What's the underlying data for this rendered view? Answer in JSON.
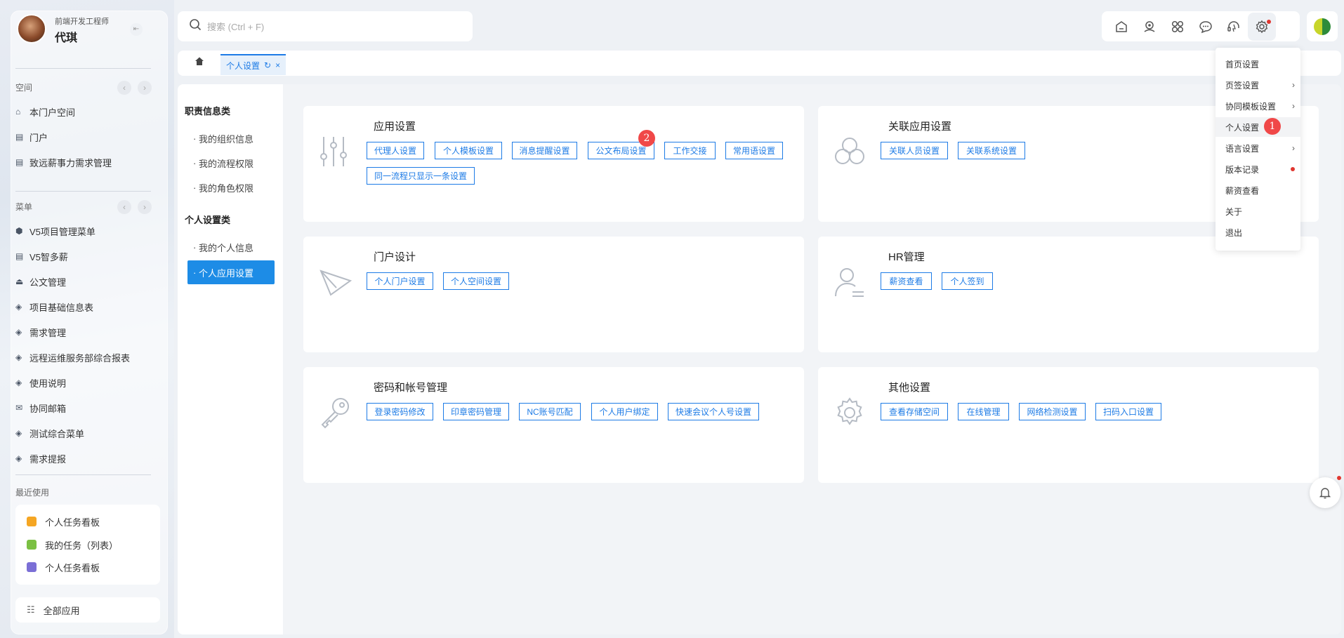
{
  "user": {
    "role": "前端开发工程师",
    "name": "代琪"
  },
  "sidebar": {
    "space_label": "空间",
    "space_items": [
      {
        "label": "本门户空间",
        "icon": "home-icon"
      },
      {
        "label": "门户",
        "icon": "doc-icon"
      },
      {
        "label": "致远薪事力需求管理",
        "icon": "doc-icon"
      }
    ],
    "menu_label": "菜单",
    "menu_items": [
      {
        "label": "V5项目管理菜单",
        "icon": "cube-icon"
      },
      {
        "label": "V5智多薪",
        "icon": "doc-icon"
      },
      {
        "label": "公文管理",
        "icon": "stamp-icon"
      },
      {
        "label": "项目基础信息表",
        "icon": "layers-icon"
      },
      {
        "label": "需求管理",
        "icon": "layers-icon"
      },
      {
        "label": "远程运维服务部综合报表",
        "icon": "layers-icon"
      },
      {
        "label": "使用说明",
        "icon": "layers-icon"
      },
      {
        "label": "协同邮箱",
        "icon": "mail-icon"
      },
      {
        "label": "测试综合菜单",
        "icon": "layers-icon"
      },
      {
        "label": "需求提报",
        "icon": "layers-icon"
      }
    ],
    "recent_label": "最近使用",
    "recent_items": [
      {
        "label": "个人任务看板",
        "color": "#f5a623"
      },
      {
        "label": "我的任务（列表）",
        "color": "#7bc043"
      },
      {
        "label": "个人任务看板",
        "color": "#7b6fd6"
      }
    ],
    "all_apps": "全部应用"
  },
  "search": {
    "placeholder": "搜索 (Ctrl + F)"
  },
  "tabs": {
    "active": "个人设置"
  },
  "left_menu": {
    "group1": "职责信息类",
    "group1_items": [
      "我的组织信息",
      "我的流程权限",
      "我的角色权限"
    ],
    "group2": "个人设置类",
    "group2_items": [
      "我的个人信息",
      "个人应用设置"
    ]
  },
  "cards": [
    {
      "title": "应用设置",
      "chips": [
        "代理人设置",
        "个人模板设置",
        "消息提醒设置",
        "公文布局设置",
        "工作交接",
        "常用语设置",
        "同一流程只显示一条设置"
      ]
    },
    {
      "title": "关联应用设置",
      "chips": [
        "关联人员设置",
        "关联系统设置"
      ]
    },
    {
      "title": "门户设计",
      "chips": [
        "个人门户设置",
        "个人空间设置"
      ]
    },
    {
      "title": "HR管理",
      "chips": [
        "薪资查看",
        "个人签到"
      ]
    },
    {
      "title": "密码和帐号管理",
      "chips": [
        "登录密码修改",
        "印章密码管理",
        "NC账号匹配",
        "个人用户绑定",
        "快速会议个人号设置"
      ]
    },
    {
      "title": "其他设置",
      "chips": [
        "查看存储空间",
        "在线管理",
        "网络检测设置",
        "扫码入口设置"
      ]
    }
  ],
  "badges": {
    "step1": "1",
    "step2": "2"
  },
  "dropdown": {
    "items": [
      "首页设置",
      "页签设置",
      "协同模板设置",
      "个人设置",
      "语言设置",
      "版本记录",
      "薪资查看",
      "关于",
      "退出"
    ]
  },
  "colors": {
    "accent": "#1d7be6",
    "badge": "#f04848"
  }
}
